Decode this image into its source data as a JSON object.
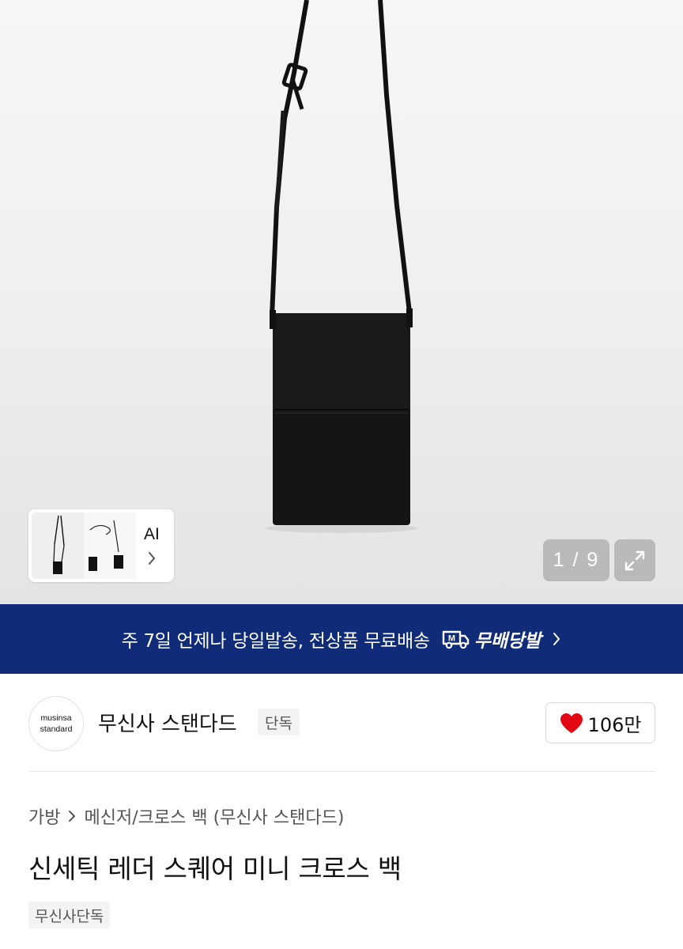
{
  "gallery": {
    "current": 1,
    "total": 9,
    "counter_text": "1 / 9",
    "ai_label": "AI",
    "product_color": "#111111"
  },
  "banner": {
    "text": "주 7일 언제나 당일발송, 전상품 무료배송",
    "badge_label": "무배당발",
    "badge_icon_letter": "M",
    "background": "#102b78"
  },
  "brand": {
    "logo_line1": "musinsa",
    "logo_line2": "standard",
    "name": "무신사 스탠다드",
    "tag": "단독"
  },
  "like": {
    "count": "106만",
    "heart_color": "#e30613"
  },
  "breadcrumb": {
    "category": "가방",
    "subcategory": "메신저/크로스 백 (무신사 스탠다드)"
  },
  "product": {
    "title": "신세틱 레더 스퀘어 미니 크로스 백",
    "badge": "무신사단독"
  }
}
